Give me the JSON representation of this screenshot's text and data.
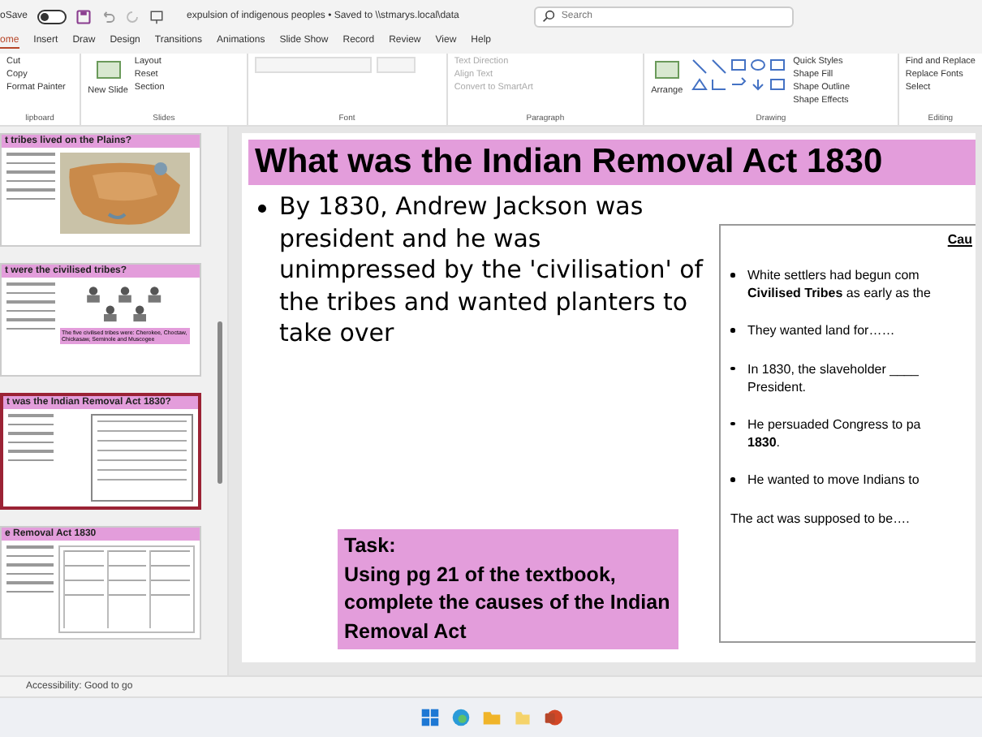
{
  "titlebar": {
    "autosave_label": "oSave",
    "autosave_on": false,
    "doc_title": "expulsion of indigenous peoples • Saved to \\\\stmarys.local\\data",
    "search": {
      "placeholder": "Search"
    }
  },
  "tabs": [
    {
      "label": "ome",
      "selected": true
    },
    {
      "label": "Insert",
      "selected": false
    },
    {
      "label": "Draw",
      "selected": false
    },
    {
      "label": "Design",
      "selected": false
    },
    {
      "label": "Transitions",
      "selected": false
    },
    {
      "label": "Animations",
      "selected": false
    },
    {
      "label": "Slide Show",
      "selected": false
    },
    {
      "label": "Record",
      "selected": false
    },
    {
      "label": "Review",
      "selected": false
    },
    {
      "label": "View",
      "selected": false
    },
    {
      "label": "Help",
      "selected": false
    }
  ],
  "ribbon": {
    "groups": [
      {
        "label": "lipboard",
        "commands": [
          "Cut",
          "Copy",
          "Format Painter"
        ]
      },
      {
        "label": "Slides",
        "big": "New Slide",
        "commands": [
          "Layout",
          "Reset",
          "Section"
        ]
      },
      {
        "label": "Font"
      },
      {
        "label": "Paragraph",
        "commands": [
          "Text Direction",
          "Align Text",
          "Convert to SmartArt"
        ]
      },
      {
        "label": "Drawing",
        "big": "Arrange",
        "commands": [
          "Quick Styles",
          "Shape Fill",
          "Shape Outline",
          "Shape Effects"
        ]
      },
      {
        "label": "Editing",
        "commands": [
          "Find and Replace",
          "Replace Fonts",
          "Select"
        ]
      }
    ]
  },
  "thumbnails": [
    {
      "title": "t tribes lived on the Plains?",
      "selected": false,
      "kind": "map"
    },
    {
      "title": "t were the civilised tribes?",
      "selected": false,
      "kind": "portraits",
      "note": "The five civilised tribes were: Cherokee, Choctaw, Chickasaw, Seminole and Muscogee"
    },
    {
      "title": "t was the Indian Removal Act 1830?",
      "selected": true,
      "kind": "task"
    },
    {
      "title": "e Removal Act 1830",
      "selected": false,
      "kind": "table"
    }
  ],
  "slide": {
    "title": "What was the Indian Removal Act 1830",
    "bullet": "By 1830, Andrew Jackson was president and he was unimpressed by the 'civilisation' of the tribes and wanted planters to take over",
    "task": "Task:\nUsing pg 21 of the textbook, complete the causes of the Indian Removal Act",
    "causes": {
      "heading": "Cau",
      "item_lines": [
        [
          "White settlers had begun com",
          "**Civilised Tribes** as early as the"
        ],
        [
          "They wanted land for……"
        ],
        [
          "In 1830, the slaveholder ____",
          "President."
        ],
        [
          "He persuaded Congress to pa",
          "**1830**."
        ],
        [
          "He wanted to move Indians to"
        ]
      ],
      "footer": "The act was supposed to be…."
    }
  },
  "status_bar": {
    "accessibility": "Accessibility: Good to go"
  }
}
